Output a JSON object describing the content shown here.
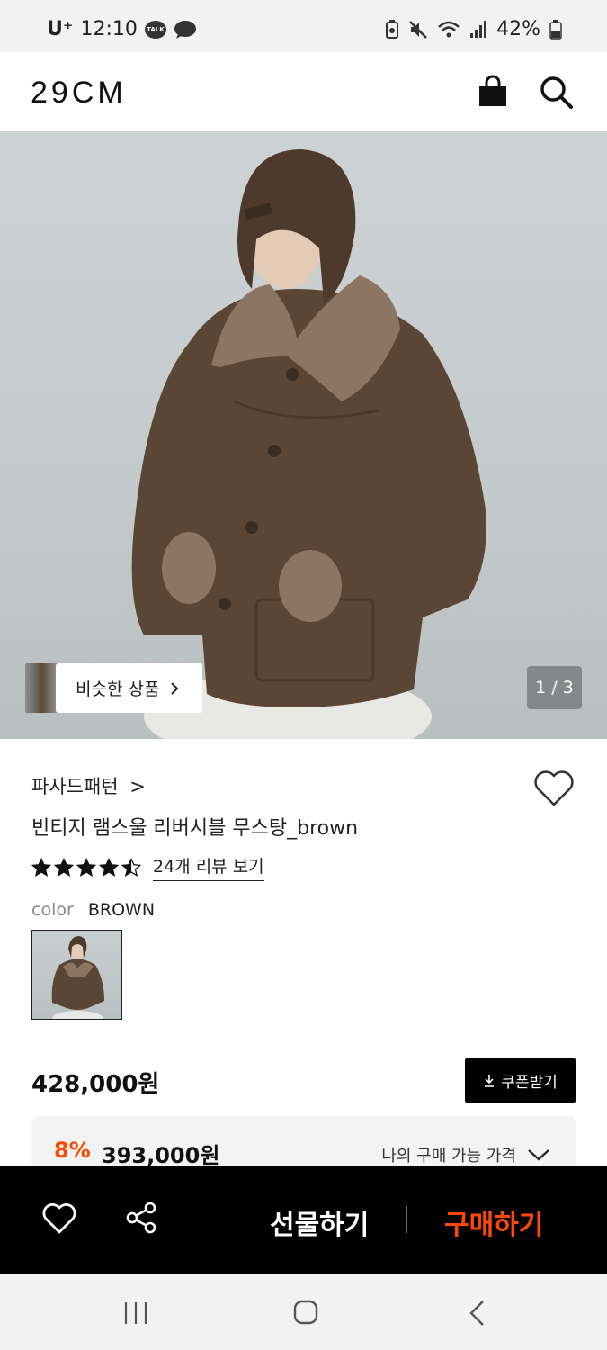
{
  "status_bar": {
    "carrier": "U⁺",
    "time": "12:10",
    "talk_label": "TALK",
    "battery": "42%"
  },
  "header": {
    "logo": "29CM"
  },
  "hero": {
    "similar_products_label": "비슷한 상품",
    "page_indicator": "1 / 3"
  },
  "product": {
    "brand": "파사드패턴",
    "brand_chevron": ">",
    "name": "빈티지 램스울 리버시블 무스탕_brown",
    "rating": 4.5,
    "review_link": "24개 리뷰 보기",
    "color_label": "color",
    "color_value": "BROWN",
    "price": "428,000원",
    "coupon_label": "쿠폰받기",
    "discount_percent": "8%",
    "discount_price": "393,000원",
    "my_price_label": "나의 구매 가능 가격"
  },
  "action_bar": {
    "gift_label": "선물하기",
    "buy_label": "구매하기"
  },
  "colors": {
    "accent": "#ff4800",
    "bar_bg": "#000000"
  }
}
